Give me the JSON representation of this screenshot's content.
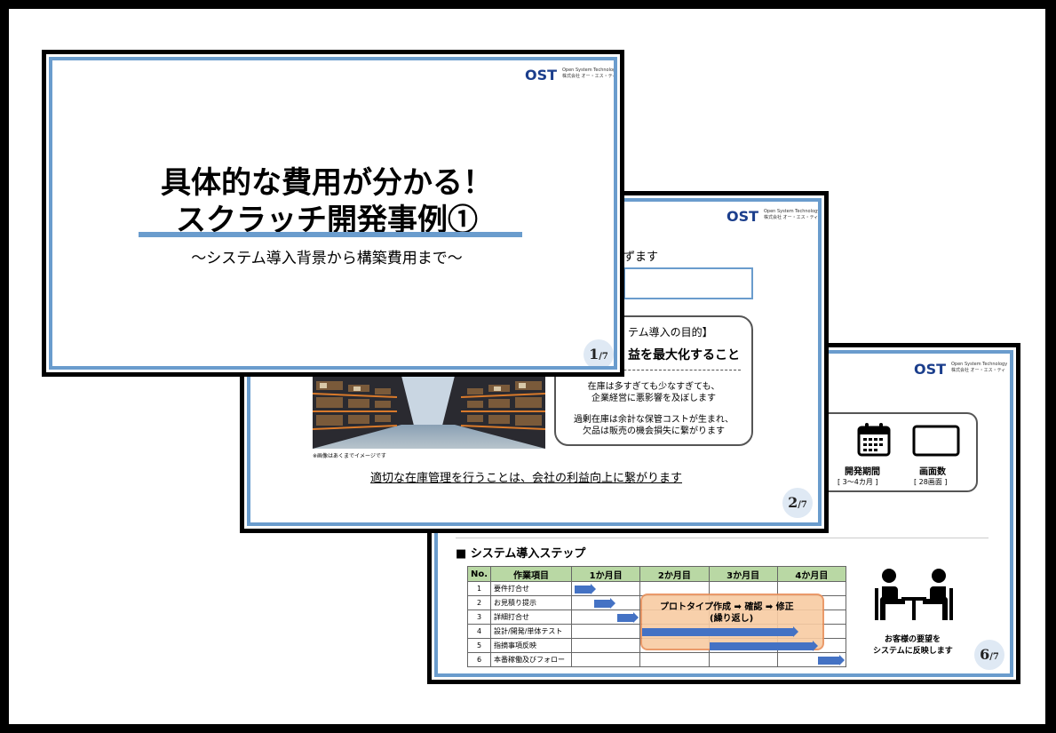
{
  "brand": {
    "logo": "OST",
    "line1": "Open System Technology",
    "line2": "株式会社 オー・エス・ティ"
  },
  "slide1": {
    "title_line1": "具体的な費用が分かる！",
    "title_line2": "スクラッチ開発事例①",
    "subtitle": "～システム導入背景から構築費用まで～",
    "page": "1",
    "page_total": "/7"
  },
  "slide2": {
    "partial_heading": "ずます",
    "purpose_title": "テム導入の目的】",
    "purpose_main": "益を最大化すること",
    "note1_line1": "在庫は多すぎても少なすぎても、",
    "note1_line2": "企業経営に悪影響を及ぼします",
    "note2_line1": "過剰在庫は余計な保管コストが生まれ、",
    "note2_line2": "欠品は販売の機会損失に繋がります",
    "image_caption": "※画像はあくまでイメージです",
    "conclusion": "適切な在庫管理を行うことは、会社の利益向上に繋がります",
    "page": "2",
    "page_total": "/7"
  },
  "slide6": {
    "period_label": "開発期間",
    "period_value": "[ 3～4カ月 ]",
    "screens_label": "画面数",
    "screens_value": "[ 28画面 ]",
    "section_title": "■ システム導入ステップ",
    "table": {
      "headers": [
        "No.",
        "作業項目",
        "1か月目",
        "2か月目",
        "3か月目",
        "4か月目"
      ],
      "rows": [
        {
          "no": "1",
          "task": "要件打合せ"
        },
        {
          "no": "2",
          "task": "お見積り提示"
        },
        {
          "no": "3",
          "task": "詳細打合せ"
        },
        {
          "no": "4",
          "task": "設計/開発/単体テスト"
        },
        {
          "no": "5",
          "task": "指摘事項反映"
        },
        {
          "no": "6",
          "task": "本番稼働及びフォロー"
        }
      ]
    },
    "prototype_line1": "プロトタイプ作成 ➡ 確認 ➡ 修正",
    "prototype_line2": "(繰り返し)",
    "customer_line1": "お客様の要望を",
    "customer_line2": "システムに反映します",
    "page": "6",
    "page_total": "/7"
  },
  "colors": {
    "frame": "#6a9ccd",
    "bar": "#4472c4",
    "header": "#b9d8a4",
    "highlight": "#f8cba3",
    "highlight_border": "#e8905a"
  }
}
